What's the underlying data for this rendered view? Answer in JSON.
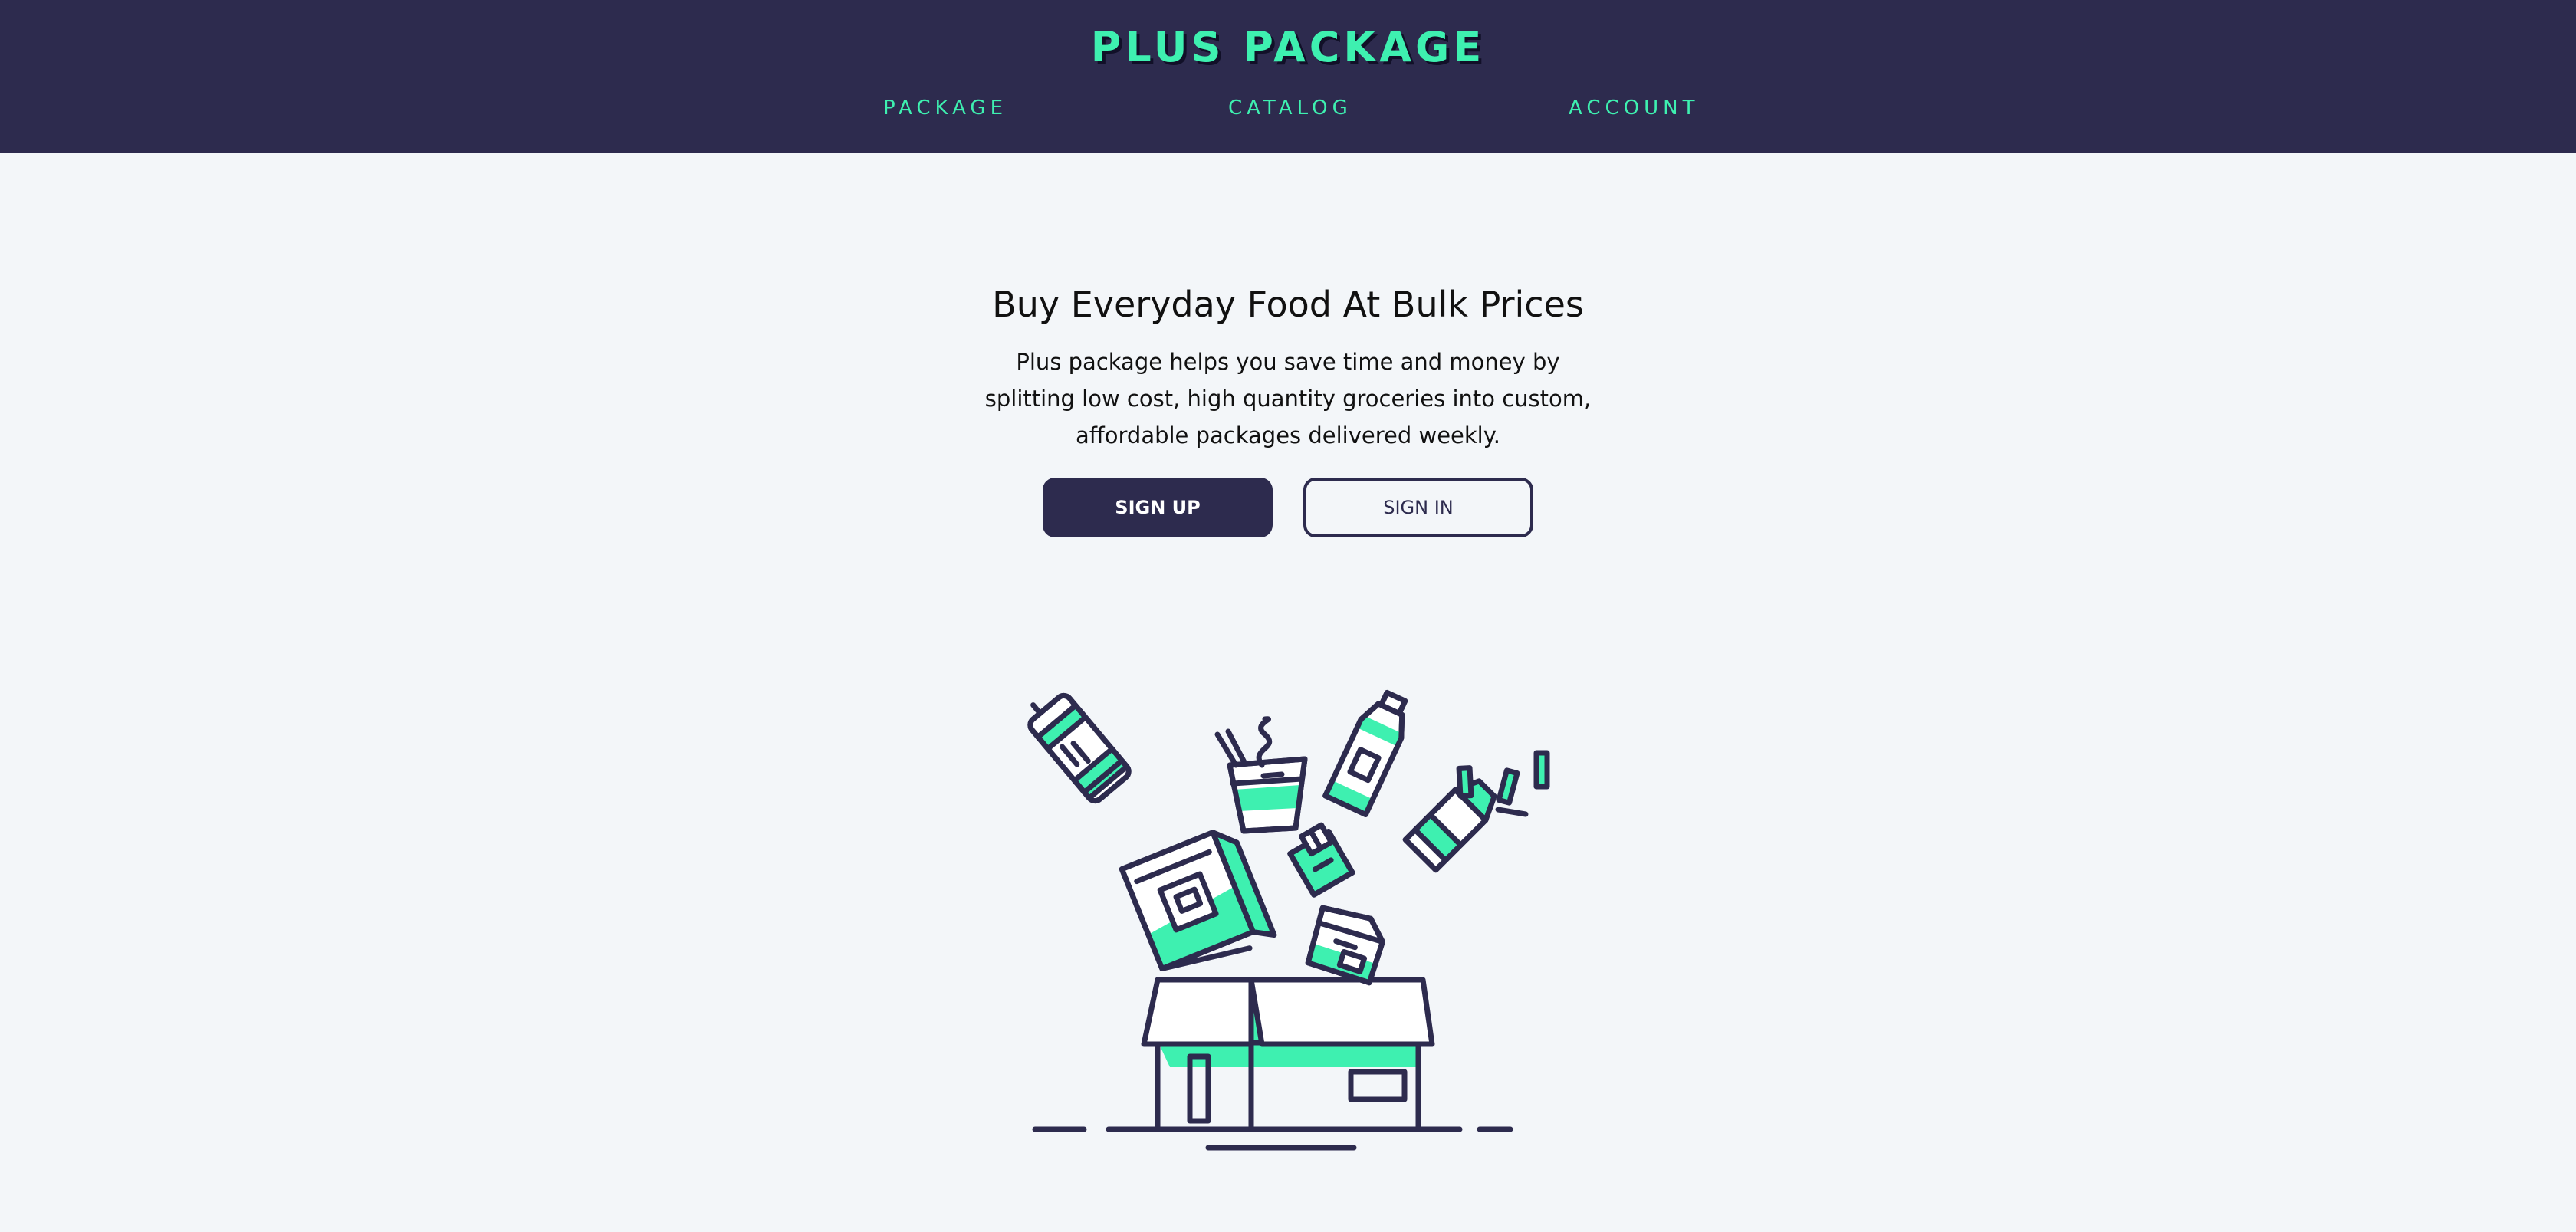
{
  "header": {
    "logo": "PLUS PACKAGE",
    "nav": [
      {
        "label": "PACKAGE"
      },
      {
        "label": "CATALOG"
      },
      {
        "label": "ACCOUNT"
      }
    ]
  },
  "hero": {
    "title": "Buy Everyday Food At Bulk Prices",
    "description": "Plus package helps you save time and money by splitting low cost, high quantity groceries into custom, affordable packages delivered weekly.",
    "signup_label": "SIGN UP",
    "signin_label": "SIGN IN"
  },
  "colors": {
    "navy": "#2d2b4e",
    "mint": "#3ef0b0",
    "background": "#f3f6f9"
  },
  "illustration": {
    "icons": [
      "grocery-box-icon",
      "soda-can-icon",
      "noodle-cup-icon",
      "bottle-icon",
      "cereal-box-icon",
      "juice-box-icon",
      "small-box-icon",
      "milk-carton-icon"
    ]
  }
}
